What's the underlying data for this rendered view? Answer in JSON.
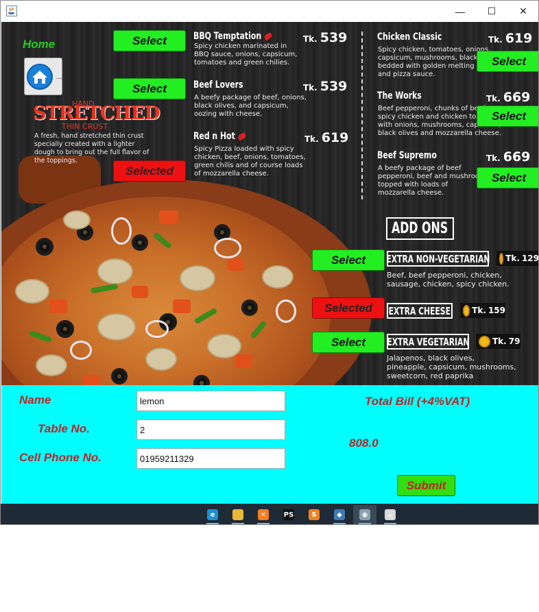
{
  "window": {
    "title": "",
    "controls": {
      "minimize": "—",
      "maximize": "☐",
      "close": "✕"
    }
  },
  "colors": {
    "select_green": "#22ee22",
    "selected_red": "#ee1111",
    "form_background": "#00ffff",
    "label_red": "#c42121",
    "home_green": "#22cc22"
  },
  "nav": {
    "home_label": "Home",
    "home_button_icon": "home-icon",
    "home_button_ellipsis": "..."
  },
  "crust": {
    "line1": "HAND",
    "line2": "STRETCHED",
    "line3": "THIN CRUST",
    "description": "A fresh, hand stretched thin crust\nspecially created with a lighter\ndough to bring out the full flavor of\nthe toppings."
  },
  "currency": "Tk.",
  "pizzas_left": [
    {
      "name": "BBQ Temptation",
      "price": "539",
      "spicy": true,
      "description": "Spicy chicken marinated in\nBBQ sauce, onions, capsicum,\ntomatoes and green chilies.",
      "button": "Select",
      "state": "unselected"
    },
    {
      "name": "Beef Lovers",
      "price": "539",
      "spicy": false,
      "description": "A beefy package of beef, onions,\nblack olives, and capsicum,\noozing with cheese.",
      "button": "Select",
      "state": "unselected"
    },
    {
      "name": "Red n Hot",
      "price": "619",
      "spicy": true,
      "description": "Spicy Pizza loaded with spicy\nchicken, beef, onions, tomatoes,\ngreen chilis and of course loads\nof mozzarella cheese.",
      "button": "Selected",
      "state": "selected"
    }
  ],
  "pizzas_right": [
    {
      "name": "Chicken Classic",
      "price": "619",
      "description": "Spicy chicken, tomatoes, onions,\ncapsicum, mushrooms, black olives\nbedded with golden melting cheese\nand pizza sauce.",
      "button": "Select",
      "state": "unselected"
    },
    {
      "name": "The Works",
      "price": "669",
      "description": "Beef pepperoni, chunks of beef,\nspicy chicken and chicken topped\nwith onions, mushrooms, capsicum,\nblack olives and mozzarella cheese.",
      "button": "Select",
      "state": "unselected"
    },
    {
      "name": "Beef Supremo",
      "price": "669",
      "description": "A beefy package of beef\npepperoni, beef and mushrooms\ntopped with loads of\nmozzarella cheese.",
      "button": "Select",
      "state": "unselected"
    }
  ],
  "addons": {
    "heading": "ADD ONS",
    "items": [
      {
        "name": "EXTRA NON-VEGETARIAN",
        "price": "129",
        "description": "Beef, beef pepperoni, chicken,\nsausage, chicken, spicy chicken.",
        "button": "Select",
        "state": "unselected"
      },
      {
        "name": "EXTRA CHEESE",
        "price": "159",
        "description": "",
        "button": "Selected",
        "state": "selected"
      },
      {
        "name": "EXTRA VEGETARIAN",
        "price": "79",
        "description": "Jalapenos, black olives,\npineapple, capsicum, mushrooms,\nsweetcorn, red paprika",
        "button": "Select",
        "state": "unselected"
      }
    ]
  },
  "form": {
    "name_label": "Name",
    "name_value": "lemon",
    "table_label": "Table No.",
    "table_value": "2",
    "phone_label": "Cell Phone No.",
    "phone_value": "01959211329",
    "total_label": "Total Bill (+4%VAT)",
    "total_value": "808.0",
    "submit_label": "Submit"
  },
  "taskbar": {
    "apps": [
      {
        "name": "edge-icon",
        "glyph": "e",
        "color": "#1c8fd8"
      },
      {
        "name": "file-explorer-icon",
        "glyph": "",
        "color": "#e9b73a"
      },
      {
        "name": "xampp-icon",
        "glyph": "✕",
        "color": "#f57c1f"
      },
      {
        "name": "phpstorm-icon",
        "glyph": "PS",
        "color": "#111111"
      },
      {
        "name": "sublime-text-icon",
        "glyph": "S",
        "color": "#f0821e"
      },
      {
        "name": "virtualbox-icon",
        "glyph": "◆",
        "color": "#3d7ab8"
      },
      {
        "name": "netbeans-icon",
        "glyph": "◉",
        "color": "#8aa0b0"
      },
      {
        "name": "java-app-icon",
        "glyph": "☕",
        "color": "#d8d8d8"
      }
    ]
  }
}
